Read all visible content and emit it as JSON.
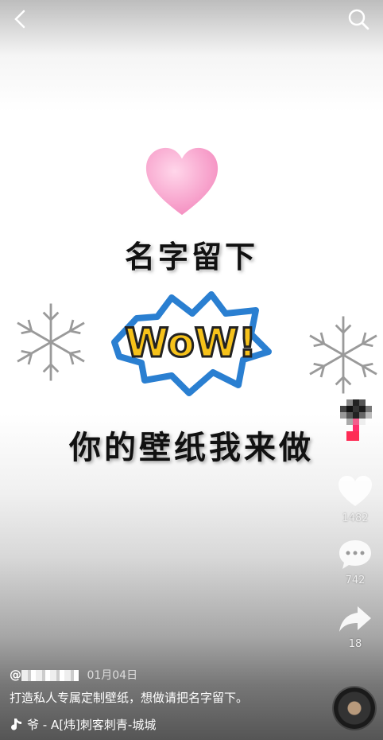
{
  "top_bar": {
    "back_icon": "chevron-left-icon",
    "search_icon": "search-icon"
  },
  "artwork": {
    "title": "名字留下",
    "wow_text": "WoW!",
    "subtitle": "你的壁纸我来做"
  },
  "actions": {
    "like_count": "1482",
    "comment_count": "742",
    "share_count": "18"
  },
  "post": {
    "handle": "@",
    "date": "01月04日",
    "caption": "打造私人专属定制壁纸，想做请把名字留下。",
    "music": "爷 - A[炜]刺客刺青-城城"
  },
  "colors": {
    "heart": "#f7a7cf",
    "wow_fill": "#f6c21a",
    "wow_border": "#2a7fd1"
  }
}
